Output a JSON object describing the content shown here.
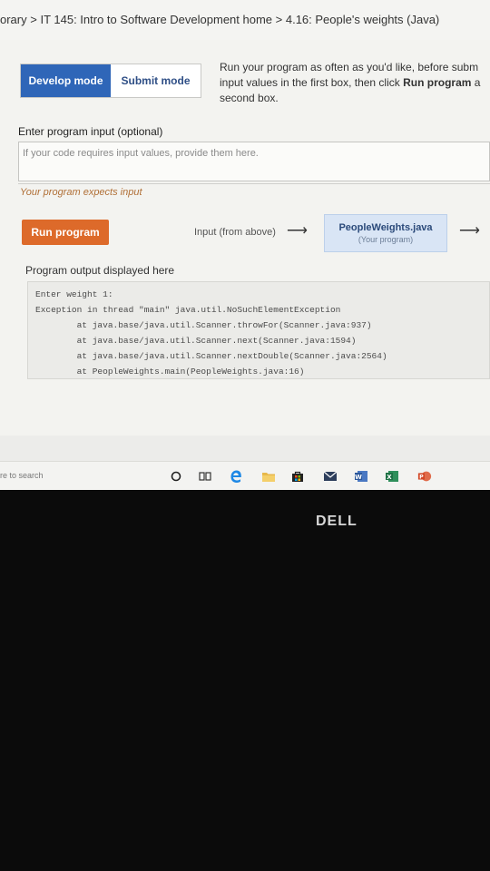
{
  "breadcrumb": {
    "items": [
      "orary",
      "IT 145: Intro to Software Development home",
      "4.16: People's weights (Java)"
    ],
    "sep": " > "
  },
  "modes": {
    "develop": "Develop mode",
    "submit": "Submit mode"
  },
  "instructions": {
    "line1": "Run your program as often as you'd like, before subm",
    "line2_prefix": "input values in the first box, then click ",
    "line2_bold": "Run program",
    "line2_suffix": " a",
    "line3": "second box."
  },
  "input": {
    "label": "Enter program input (optional)",
    "placeholder": "If your code requires input values, provide them here.",
    "value": ""
  },
  "expects_text": "Your program expects input",
  "run_button": "Run program",
  "flow": {
    "input_from": "Input (from above)",
    "arrow": "⟶",
    "file_name": "PeopleWeights.java",
    "file_sub": "(Your program)"
  },
  "output": {
    "label": "Program output displayed here",
    "text": "Enter weight 1:\nException in thread \"main\" java.util.NoSuchElementException\n        at java.base/java.util.Scanner.throwFor(Scanner.java:937)\n        at java.base/java.util.Scanner.next(Scanner.java:1594)\n        at java.base/java.util.Scanner.nextDouble(Scanner.java:2564)\n        at PeopleWeights.main(PeopleWeights.java:16)"
  },
  "taskbar": {
    "search_text": "re to search",
    "icons": [
      "cortana-circle-icon",
      "task-view-icon",
      "edge-icon",
      "file-explorer-icon",
      "store-icon",
      "mail-icon",
      "word-icon",
      "excel-icon",
      "powerpoint-icon"
    ],
    "colors": {
      "edge": "#1e88e5",
      "word": "#2b579a",
      "excel": "#1e7145",
      "powerpoint": "#d24726"
    }
  },
  "brand": "DELL"
}
